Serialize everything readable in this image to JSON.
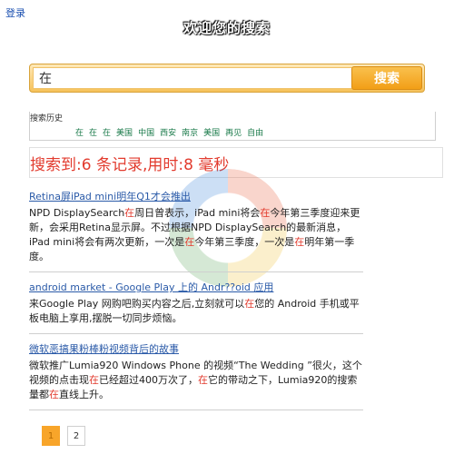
{
  "header": {
    "login_label": "登录",
    "welcome_title": "欢迎您的搜索"
  },
  "search": {
    "query": "在",
    "button_label": "搜索"
  },
  "history": {
    "label": "搜索历史",
    "items": [
      "在",
      "在",
      "在",
      "美国",
      "中国",
      "西安",
      "南京",
      "美国",
      "再见",
      "自由"
    ]
  },
  "stats": {
    "text": "搜索到:6 条记录,用时:8 毫秒"
  },
  "results": [
    {
      "title": "Retina屏iPad mini明年Q1才会推出",
      "snippet": [
        {
          "t": "NPD DisplaySearch"
        },
        {
          "t": "在",
          "hl": true
        },
        {
          "t": "周日曾表示，iPad mini将会"
        },
        {
          "t": "在",
          "hl": true
        },
        {
          "t": "今年第三季度迎来更新，会采用Retina显示屏。不过根据NPD DisplaySearch的最新消息，iPad mini将会有两次更新，一次是"
        },
        {
          "t": "在",
          "hl": true
        },
        {
          "t": "今年第三季度，一次是"
        },
        {
          "t": "在",
          "hl": true
        },
        {
          "t": "明年第一季度。"
        }
      ]
    },
    {
      "title": "android market - Google Play 上的 Andr??oid 应用",
      "snippet": [
        {
          "t": "来Google Play 网购吧购买内容之后,立刻就可以"
        },
        {
          "t": "在",
          "hl": true
        },
        {
          "t": "您的 Android 手机或平板电脑上享用,摆脱一切同步烦恼。"
        }
      ]
    },
    {
      "title": "微软恶搞果粉棒粉视频背后的故事",
      "snippet": [
        {
          "t": "微软推广Lumia920 Windows Phone 的视频“The Wedding ”很火，这个视频的点击现"
        },
        {
          "t": "在",
          "hl": true
        },
        {
          "t": "已经超过400万次了，"
        },
        {
          "t": "在",
          "hl": true
        },
        {
          "t": "它的带动之下，Lumia920的搜索量都"
        },
        {
          "t": "在",
          "hl": true
        },
        {
          "t": "直线上升。"
        }
      ]
    }
  ],
  "pagination": {
    "pages": [
      "1",
      "2"
    ],
    "current": "1"
  },
  "colors": {
    "accent_orange": "#f29f17",
    "highlight_red": "#e23b2e",
    "link_blue": "#2a5aa8",
    "history_green": "#1a7a4a"
  }
}
